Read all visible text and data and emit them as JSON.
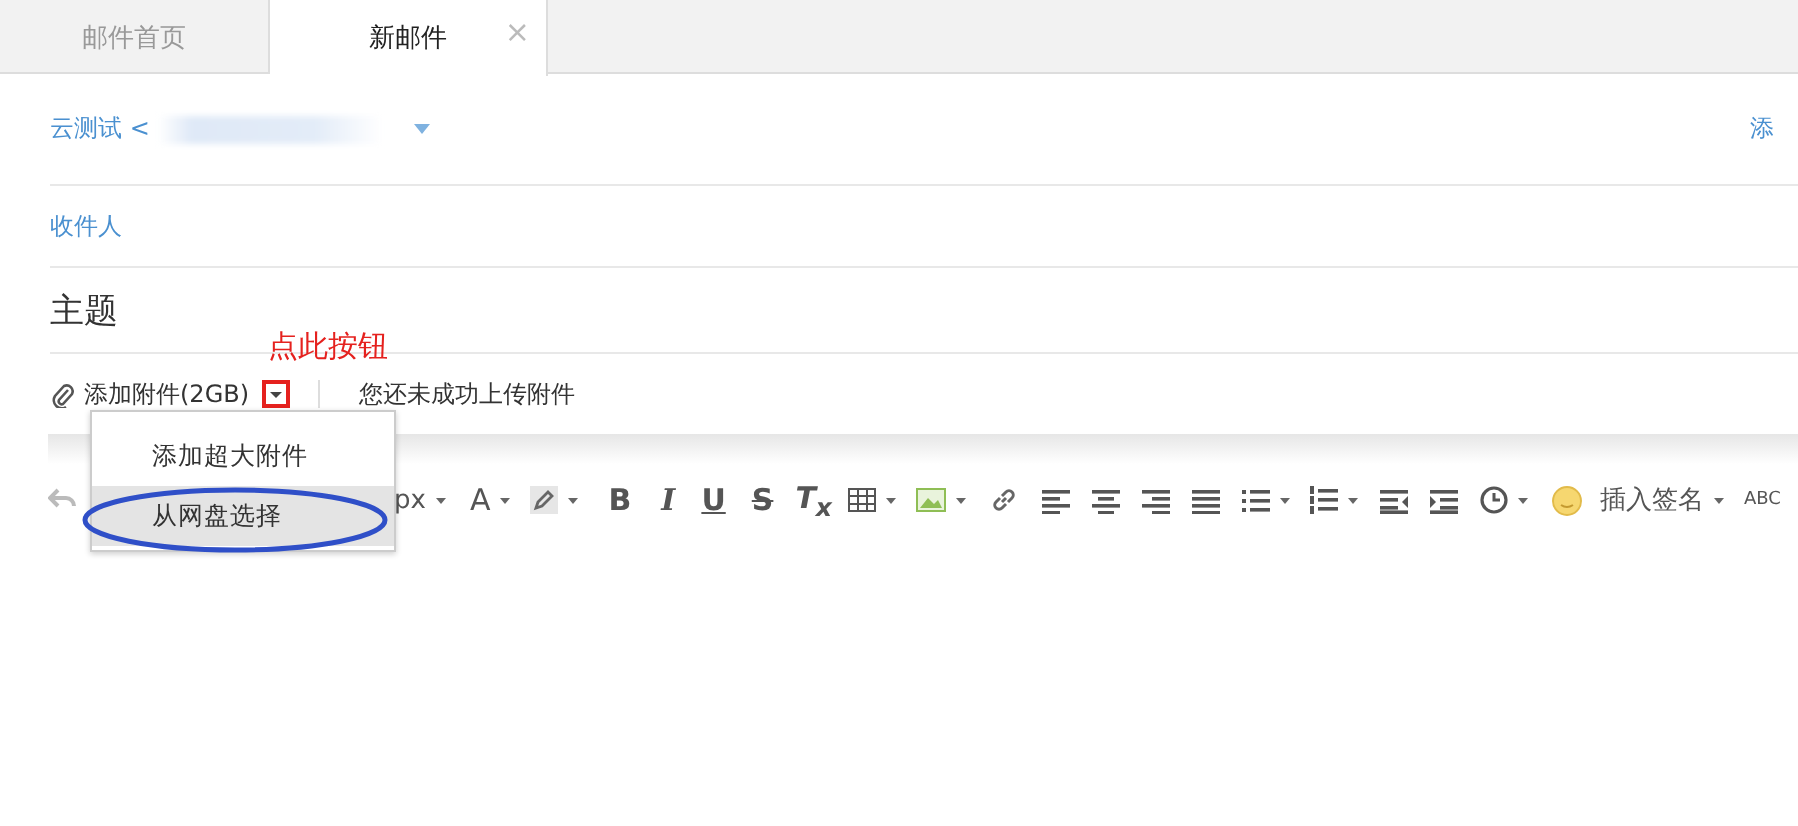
{
  "tabs": [
    {
      "label": "邮件首页",
      "selected": false
    },
    {
      "label": "新邮件",
      "selected": true,
      "close": "×"
    }
  ],
  "sender": {
    "label": "云测试 <",
    "action": "添"
  },
  "recipients": {
    "label": "收件人"
  },
  "subject": {
    "placeholder": "主题"
  },
  "attachment": {
    "label": "添加附件(2GB)",
    "status": "您还未成功上传附件"
  },
  "annotation": "点此按钮",
  "menu": [
    {
      "label": "添加超大附件",
      "selected": false
    },
    {
      "label": "从网盘选择",
      "selected": true
    }
  ],
  "toolbar": {
    "font_size": "px",
    "font_color": "A",
    "bold": "B",
    "italic": "I",
    "underline": "U",
    "strikethrough": "S",
    "clear_format": "T$_{x}$",
    "signature": "插入签名",
    "spellcheck": "ABC"
  }
}
